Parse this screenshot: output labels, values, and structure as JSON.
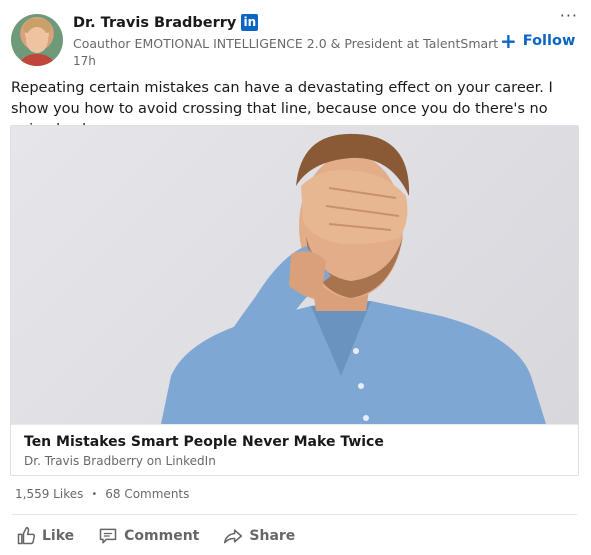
{
  "post": {
    "author": {
      "name": "Dr. Travis Bradberry",
      "headline": "Coauthor EMOTIONAL INTELLIGENCE 2.0 & President at TalentSmart",
      "time": "17h",
      "badge": "in"
    },
    "follow_label": "Follow",
    "follow_icon": "+",
    "more_icon": "···",
    "commentary": "Repeating certain mistakes can have a devastating effect on your career. I show you how to avoid crossing that line, because once you do there's no going back.",
    "article": {
      "title": "Ten Mistakes Smart People Never Make Twice",
      "source": "Dr. Travis Bradberry on LinkedIn"
    },
    "social": {
      "likes": "1,559 Likes",
      "separator": "•",
      "comments": "68 Comments"
    },
    "actions": {
      "like": "Like",
      "comment": "Comment",
      "share": "Share"
    }
  },
  "colors": {
    "brand": "#0a66c2",
    "text": "#000000",
    "muted": "#666666"
  }
}
